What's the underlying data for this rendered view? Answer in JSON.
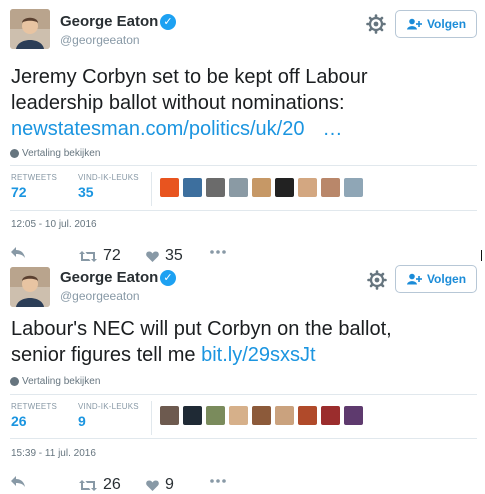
{
  "tweets": [
    {
      "name": "George Eaton",
      "handle": "@georgeeaton",
      "follow_label": "Volgen",
      "text_line1": "Jeremy Corbyn set to be kept off Labour",
      "text_line2": "leadership ballot without nominations:",
      "link_text": "newstatesman.com/politics/uk/20",
      "ellipsis": "…",
      "translate": "Vertaling bekijken",
      "retweets_label": "RETWEETS",
      "retweets": "72",
      "likes_label": "VIND-IK-LEUKS",
      "likes": "35",
      "timestamp": "12:05 - 10 jul. 2016",
      "retweet_count": "72",
      "like_count": "35",
      "face_colors": [
        "#e8541f",
        "#3d6f9e",
        "#6b6b6b",
        "#8a9aa4",
        "#c69866",
        "#222222",
        "#d3a781",
        "#b9876a",
        "#8fa6b6"
      ]
    },
    {
      "name": "George Eaton",
      "handle": "@georgeeaton",
      "follow_label": "Volgen",
      "text_line1": "Labour's NEC will put Corbyn on the ballot,",
      "text_line2_prefix": "senior figures tell me",
      "link_text": "bit.ly/29sxsJt",
      "translate": "Vertaling bekijken",
      "retweets_label": "RETWEETS",
      "retweets": "26",
      "likes_label": "VIND-IK-LEUKS",
      "likes": "9",
      "timestamp": "15:39 - 11 jul. 2016",
      "retweet_count": "26",
      "like_count": "9",
      "face_colors": [
        "#6d5a4f",
        "#1f2a35",
        "#7a8b5c",
        "#d6b08a",
        "#8c5a3a",
        "#caa27e",
        "#b04a2a",
        "#9b2d2d",
        "#5e3a6e"
      ]
    }
  ],
  "colors": {
    "accent": "#1b95e0",
    "verified": "#1da1f2",
    "muted": "#8899a6"
  }
}
